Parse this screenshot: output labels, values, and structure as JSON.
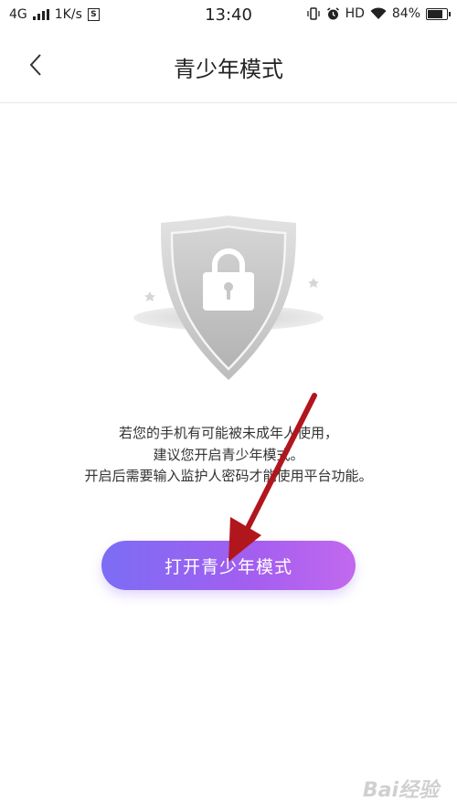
{
  "status_bar": {
    "network": "4G",
    "speed": "1K/s",
    "sim_badge": "S",
    "time": "13:40",
    "hd": "HD",
    "battery": "84%"
  },
  "nav": {
    "back_icon": "chevron-left-icon",
    "title": "青少年模式"
  },
  "illustration": {
    "icon": "shield-lock-icon"
  },
  "message": {
    "line1": "若您的手机有可能被未成年人使用，",
    "line2": "建议您开启青少年模式。",
    "line3": "开启后需要输入监护人密码才能使用平台功能。"
  },
  "button": {
    "label": "打开青少年模式",
    "gradient_start": "#7c6df4",
    "gradient_end": "#c269ee"
  },
  "annotation": {
    "arrow_color": "#b1161c"
  },
  "watermark": {
    "text": "Bai经验"
  }
}
